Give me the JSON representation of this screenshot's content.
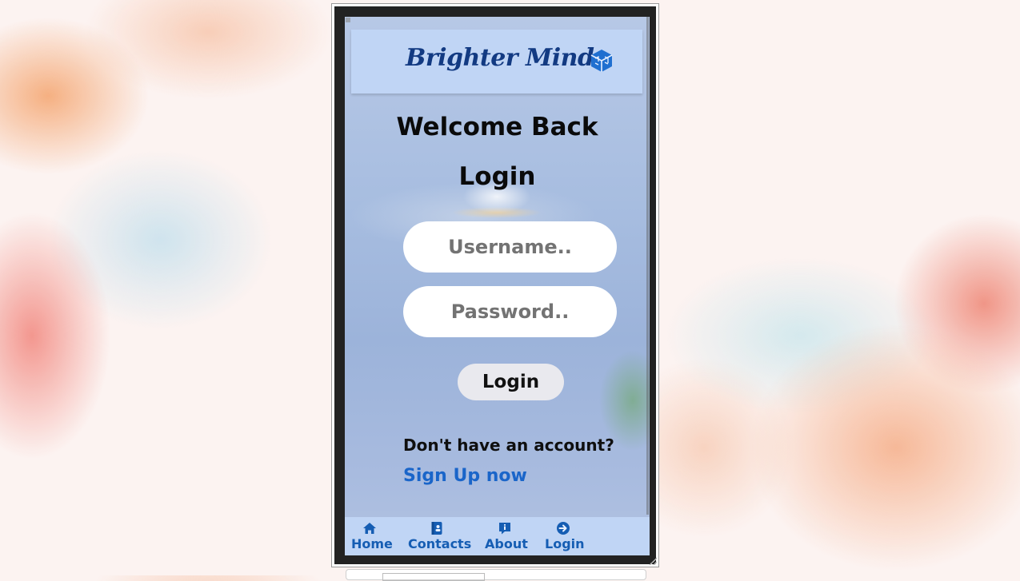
{
  "header": {
    "brand": "Brighter Minds",
    "logo_icon": "cube-logo-icon"
  },
  "form": {
    "welcome": "Welcome Back",
    "title": "Login",
    "username_placeholder": "Username..",
    "password_placeholder": "Password..",
    "login_button": "Login",
    "no_account_text": "Don't have an account?",
    "signup_link": "Sign Up now"
  },
  "nav": {
    "items": [
      {
        "label": "Home",
        "icon": "home-icon"
      },
      {
        "label": "Contacts",
        "icon": "contacts-icon"
      },
      {
        "label": "About",
        "icon": "info-icon"
      },
      {
        "label": "Login",
        "icon": "login-arrow-icon"
      }
    ]
  },
  "colors": {
    "header_bg": "#c0d5f5",
    "brand": "#123a82",
    "accent": "#155db3",
    "link": "#1a65c9"
  }
}
